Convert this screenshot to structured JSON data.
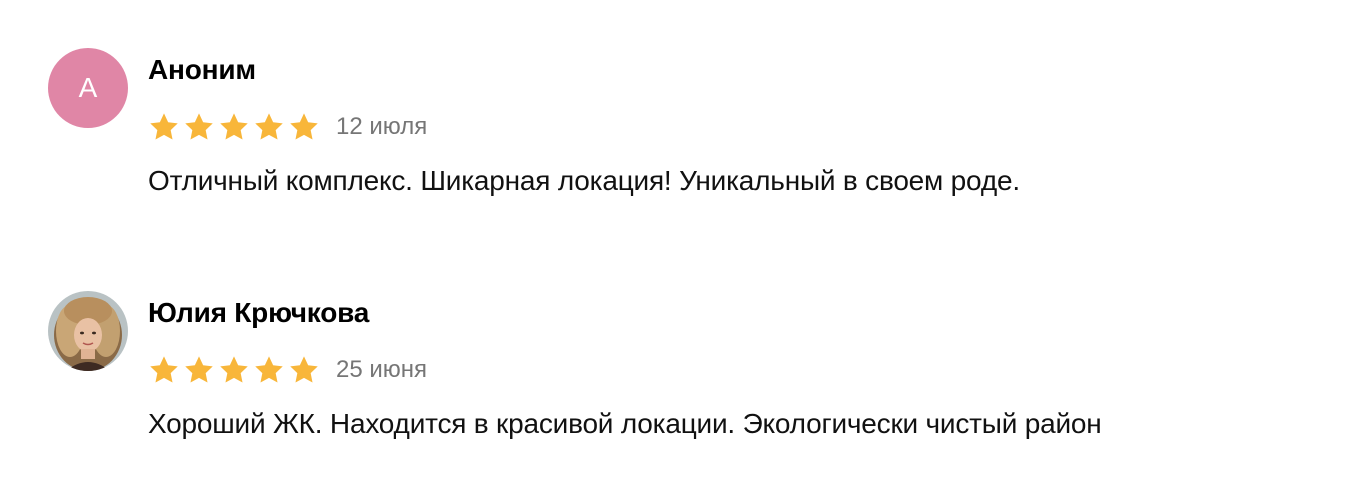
{
  "reviews": [
    {
      "avatar_letter": "А",
      "author": "Аноним",
      "rating": 5,
      "date": "12 июля",
      "text": "Отличный комплекс. Шикарная локация! Уникальный в своем роде."
    },
    {
      "avatar_letter": "",
      "author": "Юлия Крючкова",
      "rating": 5,
      "date": "25 июня",
      "text": "Хороший ЖК. Находится в красивой локации. Экологически чистый район"
    }
  ],
  "colors": {
    "avatar_bg": "#e086a6",
    "star": "#f8b63a",
    "date": "#767676"
  },
  "icons": {
    "star": "star-icon"
  }
}
